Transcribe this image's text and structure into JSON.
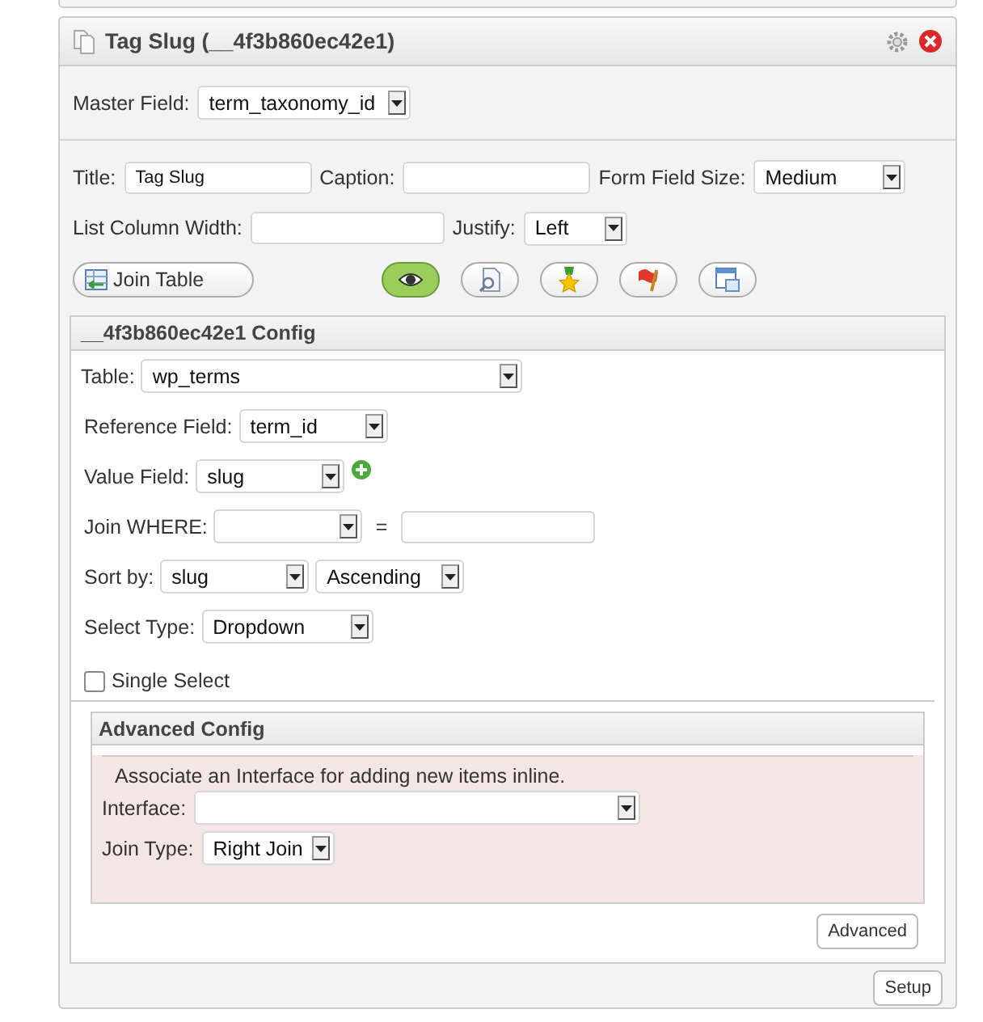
{
  "panel": {
    "title": "Tag Slug (__4f3b860ec42e1)",
    "master_field": {
      "label": "Master Field:",
      "value": "term_taxonomy_id"
    },
    "title_field": {
      "label": "Title:",
      "value": "Tag Slug"
    },
    "caption_field": {
      "label": "Caption:"
    },
    "form_field_size": {
      "label": "Form Field Size:",
      "value": "Medium"
    },
    "list_column_width": {
      "label": "List Column Width:"
    },
    "justify": {
      "label": "Justify:",
      "value": "Left"
    },
    "join_table_button": "Join Table",
    "view_buttons": [
      {
        "selected": true
      },
      {
        "selected": false
      },
      {
        "selected": false
      },
      {
        "selected": false
      },
      {
        "selected": false
      }
    ],
    "config": {
      "title": "__4f3b860ec42e1 Config",
      "table": {
        "label": "Table:",
        "value": "wp_terms"
      },
      "reference_field": {
        "label": "Reference Field:",
        "value": "term_id"
      },
      "value_field": {
        "label": "Value Field:",
        "value": "slug"
      },
      "join_where": {
        "label": "Join WHERE:",
        "operator": "="
      },
      "sort_by": {
        "label": "Sort by:",
        "field": "slug",
        "order": "Ascending"
      },
      "select_type": {
        "label": "Select Type:",
        "value": "Dropdown"
      },
      "single_select": {
        "label": "Single Select",
        "checked": false
      },
      "advanced_config": {
        "title": "Advanced Config",
        "description": "Associate an Interface for adding new items inline.",
        "interface": {
          "label": "Interface:"
        },
        "join_type": {
          "label": "Join Type:",
          "value": "Right Join"
        }
      },
      "advanced_button": "Advanced"
    },
    "setup_button": "Setup"
  }
}
